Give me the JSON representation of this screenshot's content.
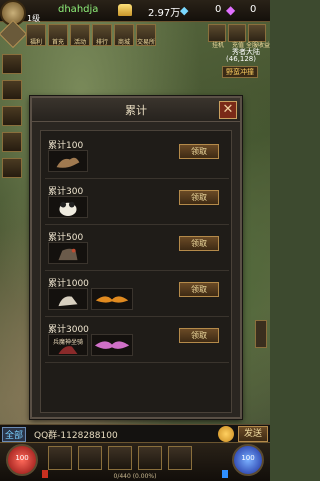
{
  "player": {
    "level": "1级",
    "name": "dhahdja"
  },
  "currency": {
    "gold": "2.97万",
    "diamond": "0",
    "bind_diamond": "0"
  },
  "top_icons": [
    "福利",
    "首充",
    "活动",
    "排行",
    "商城",
    "交易所"
  ],
  "minimap": {
    "icons": [
      "挂机",
      "充值",
      "全服收益"
    ],
    "name": "秀者大陆",
    "coords": "(46,128)",
    "button": "野蛮冲撞"
  },
  "modal": {
    "title": "累计",
    "close": "✕",
    "claim_label": "领取",
    "rows": [
      {
        "label": "累计100",
        "items": [
          "dragon"
        ]
      },
      {
        "label": "累计300",
        "items": [
          "panda"
        ]
      },
      {
        "label": "累计500",
        "items": [
          "horse"
        ]
      },
      {
        "label": "累计1000",
        "items": [
          "beast",
          "wings"
        ]
      },
      {
        "label": "累计3000",
        "items": [
          "mount-text",
          "wings-pink"
        ]
      }
    ],
    "mount_caption": "兵魔神坐骑"
  },
  "chat": {
    "tab": "全部",
    "message": "QQ群-1128288100",
    "send": "发送"
  },
  "bottom": {
    "hp": "100",
    "mp": "100",
    "exp": "0/440 (0.00%)"
  },
  "colors": {
    "accent": "#b48a4a",
    "panel": "#2a2621",
    "hp": "#c82020",
    "mp": "#2050c8"
  }
}
